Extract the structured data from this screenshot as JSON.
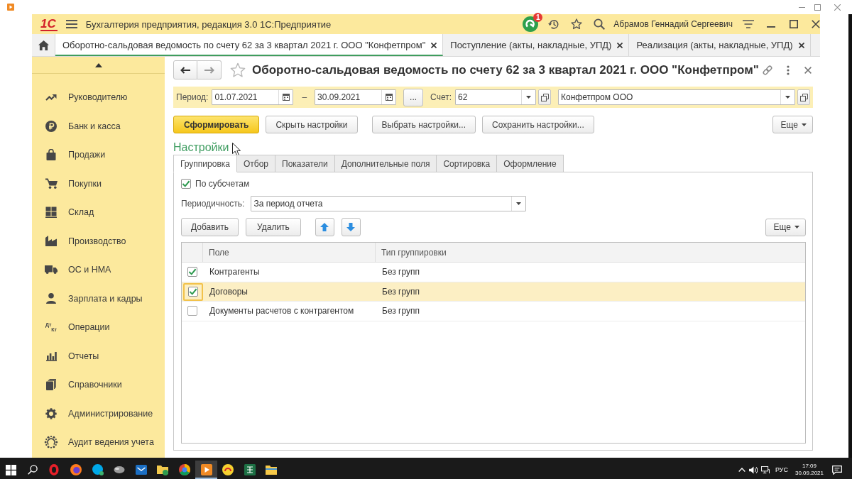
{
  "window": {
    "logo": "1С",
    "title": "Бухгалтерия предприятия, редакция 3.0 1С:Предприятие",
    "notification_count": "1",
    "user": "Абрамов Геннадий Сергеевич"
  },
  "open_tabs": [
    {
      "label": "Оборотно-сальдовая ведомость по счету 62 за 3 квартал 2021 г. ООО \"Конфетпром\"",
      "selected": true
    },
    {
      "label": "Поступление (акты, накладные, УПД)",
      "selected": false
    },
    {
      "label": "Реализация (акты, накладные, УПД)",
      "selected": false
    }
  ],
  "sidebar": {
    "items": [
      {
        "label": "Руководителю"
      },
      {
        "label": "Банк и касса"
      },
      {
        "label": "Продажи"
      },
      {
        "label": "Покупки"
      },
      {
        "label": "Склад"
      },
      {
        "label": "Производство"
      },
      {
        "label": "ОС и НМА"
      },
      {
        "label": "Зарплата и кадры"
      },
      {
        "label": "Операции",
        "icon_text": [
          "Дт",
          "Кт"
        ]
      },
      {
        "label": "Отчеты"
      },
      {
        "label": "Справочники"
      },
      {
        "label": "Администрирование"
      },
      {
        "label": "Аудит ведения учета"
      }
    ]
  },
  "form": {
    "title": "Оборотно-сальдовая ведомость по счету 62 за 3 квартал 2021 г. ООО \"Конфетпром\"",
    "period_label": "Период:",
    "date_from": "01.07.2021",
    "period_dash": "–",
    "date_to": "30.09.2021",
    "period_button": "...",
    "account_label": "Счет:",
    "account": "62",
    "organization": "Конфетпром ООО"
  },
  "actions": [
    {
      "label": "Сформировать",
      "kind": "primary"
    },
    {
      "label": "Скрыть настройки",
      "kind": "default"
    },
    {
      "label": "Выбрать настройки...",
      "kind": "default"
    },
    {
      "label": "Сохранить настройки...",
      "kind": "default"
    }
  ],
  "actions_more": "Еще",
  "settings": {
    "title": "Настройки",
    "tabs": [
      {
        "label": "Группировка",
        "selected": true
      },
      {
        "label": "Отбор",
        "selected": false
      },
      {
        "label": "Показатели",
        "selected": false
      },
      {
        "label": "Дополнительные поля",
        "selected": false
      },
      {
        "label": "Сортировка",
        "selected": false
      },
      {
        "label": "Оформление",
        "selected": false
      }
    ],
    "by_subaccounts": {
      "label": "По субсчетам",
      "checked": true
    },
    "periodicity": {
      "label": "Периодичность:",
      "value": "За период отчета"
    },
    "buttons": [
      "Добавить",
      "Удалить"
    ],
    "more": "Еще",
    "table": {
      "columns": [
        "Поле",
        "Тип группировки"
      ],
      "rows": [
        {
          "checked": true,
          "field": "Контрагенты",
          "grouping": "Без групп",
          "selected": false
        },
        {
          "checked": true,
          "field": "Договоры",
          "grouping": "Без групп",
          "selected": true
        },
        {
          "checked": false,
          "field": "Документы расчетов с контрагентом",
          "grouping": "Без групп",
          "selected": false
        }
      ]
    }
  },
  "taskbar": {
    "apps": [
      {
        "selected": false
      },
      {
        "selected": false
      },
      {
        "selected": false
      },
      {
        "selected": false
      },
      {
        "selected": false
      },
      {
        "selected": false
      },
      {
        "selected": false
      },
      {
        "selected": true
      },
      {
        "selected": false
      },
      {
        "selected": false
      },
      {
        "selected": false
      }
    ],
    "language": "РУС",
    "time": "17:09",
    "date": "30.09.2021"
  }
}
